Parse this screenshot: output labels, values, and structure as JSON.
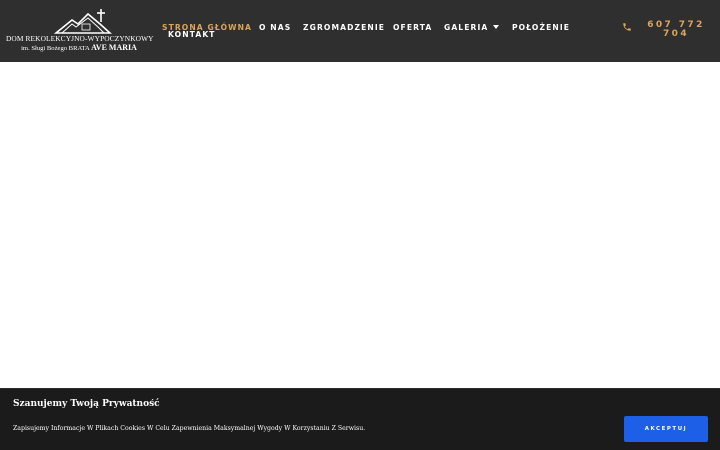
{
  "header": {
    "logo": {
      "line1": "DOM REKOLEKCYJNO-WYPOCZYNKOWY",
      "line2_prefix": "im. Sługi Bożego BRATA ",
      "line2_bold": "AVE MARIA"
    },
    "nav": [
      {
        "label": "STRONA GŁÓWNA",
        "active": true
      },
      {
        "label": "O NAS"
      },
      {
        "label": "ZGROMADZENIE"
      },
      {
        "label": "OFERTA"
      },
      {
        "label": "GALERIA",
        "has_dropdown": true
      },
      {
        "label": "POŁOŻENIE"
      },
      {
        "label": "KONTAKT"
      }
    ],
    "phone": {
      "icon": "phone-icon",
      "number": "607 772 704"
    },
    "colors": {
      "background": "#2f2f2f",
      "accent": "#d9a55b"
    }
  },
  "cookie_banner": {
    "title": "Szanujemy Twoją Prywatność",
    "text": "Zapisujemy Informacje W Plikach Cookies W Celu Zapewnienia Maksymalnej Wygody W Korzystaniu Z Serwisu.",
    "accept_label": "AKCEPTUJ",
    "button_color": "#1d5fe6"
  }
}
